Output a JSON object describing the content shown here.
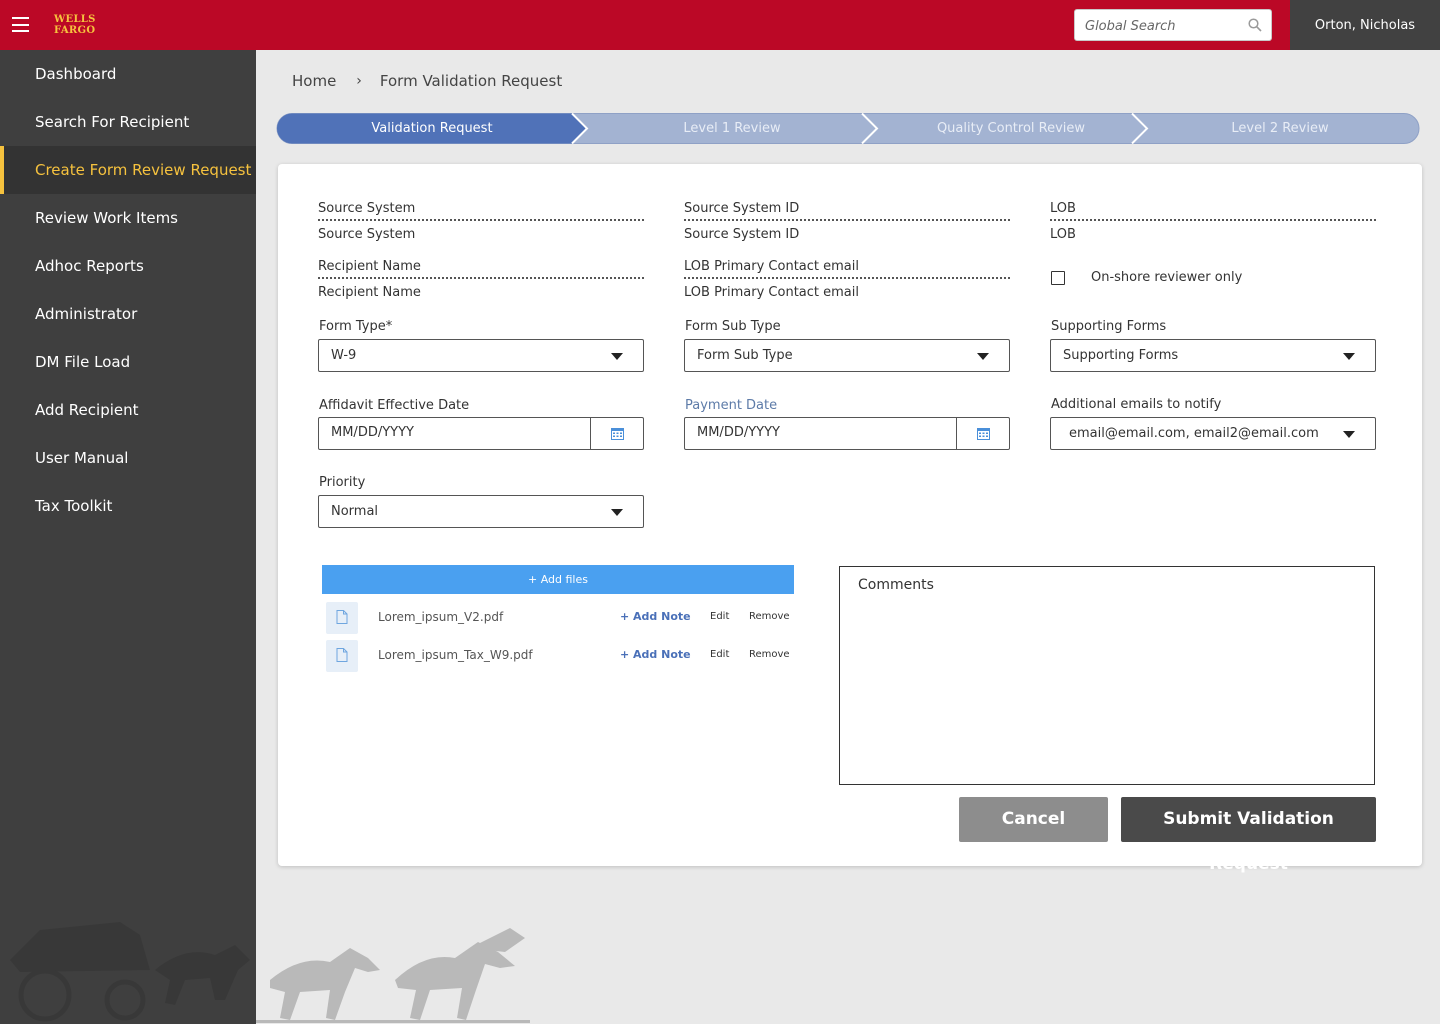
{
  "header": {
    "logo_line1": "WELLS",
    "logo_line2": "FARGO",
    "search_placeholder": "Global Search",
    "user_name": "Orton, Nicholas"
  },
  "sidebar": {
    "items": [
      {
        "label": "Dashboard",
        "active": false
      },
      {
        "label": "Search For Recipient",
        "active": false
      },
      {
        "label": "Create Form Review Request",
        "active": true
      },
      {
        "label": "Review Work Items",
        "active": false
      },
      {
        "label": "Adhoc Reports",
        "active": false
      },
      {
        "label": "Administrator",
        "active": false
      },
      {
        "label": "DM File Load",
        "active": false
      },
      {
        "label": "Add Recipient",
        "active": false
      },
      {
        "label": "User Manual",
        "active": false
      },
      {
        "label": "Tax Toolkit",
        "active": false
      }
    ]
  },
  "breadcrumb": {
    "home": "Home",
    "separator": "›",
    "current": "Form Validation Request"
  },
  "stepper": {
    "steps": [
      {
        "label": "Validation Request",
        "state": "active"
      },
      {
        "label": "Level 1 Review",
        "state": "pending"
      },
      {
        "label": "Quality Control Review",
        "state": "pending"
      },
      {
        "label": "Level 2 Review",
        "state": "pending"
      }
    ]
  },
  "form": {
    "source_system": {
      "label": "Source System",
      "value": "Source System"
    },
    "source_system_id": {
      "label": "Source System ID",
      "value": "Source System ID"
    },
    "lob": {
      "label": "LOB",
      "value": "LOB"
    },
    "recipient_name": {
      "label": "Recipient Name",
      "value": "Recipient Name"
    },
    "lob_contact": {
      "label": "LOB Primary Contact email",
      "value": "LOB Primary Contact email"
    },
    "onshore": {
      "label": "On-shore reviewer only",
      "checked": false
    },
    "form_type": {
      "label": "Form Type*",
      "value": "W-9"
    },
    "form_sub_type": {
      "label": "Form Sub Type",
      "value": "Form Sub Type"
    },
    "supporting_forms": {
      "label": "Supporting Forms",
      "value": "Supporting Forms"
    },
    "affidavit_date": {
      "label": "Affidavit Effective Date",
      "placeholder": "MM/DD/YYYY"
    },
    "payment_date": {
      "label": "Payment Date",
      "placeholder": "MM/DD/YYYY"
    },
    "additional_emails": {
      "label": "Additional emails to notify",
      "value": "email@email.com, email2@email.com"
    },
    "priority": {
      "label": "Priority",
      "value": "Normal"
    }
  },
  "files": {
    "add_label": "+ Add files",
    "items": [
      {
        "name": "Lorem_ipsum_V2.pdf",
        "add_note": "+ Add Note",
        "edit": "Edit",
        "remove": "Remove"
      },
      {
        "name": "Lorem_ipsum_Tax_W9.pdf",
        "add_note": "+ Add Note",
        "edit": "Edit",
        "remove": "Remove"
      }
    ]
  },
  "comments": {
    "placeholder": "Comments"
  },
  "actions": {
    "cancel": "Cancel",
    "submit": "Submit Validation Request"
  },
  "colors": {
    "brand_red": "#bb0826",
    "brand_gold": "#f6c23e",
    "step_active": "#5072b8",
    "step_pending": "#a3b3d2",
    "add_files_blue": "#4aa0f0"
  },
  "icons": {
    "menu": "hamburger-menu-icon",
    "search": "search-icon",
    "calendar": "calendar-icon",
    "file": "document-icon"
  }
}
